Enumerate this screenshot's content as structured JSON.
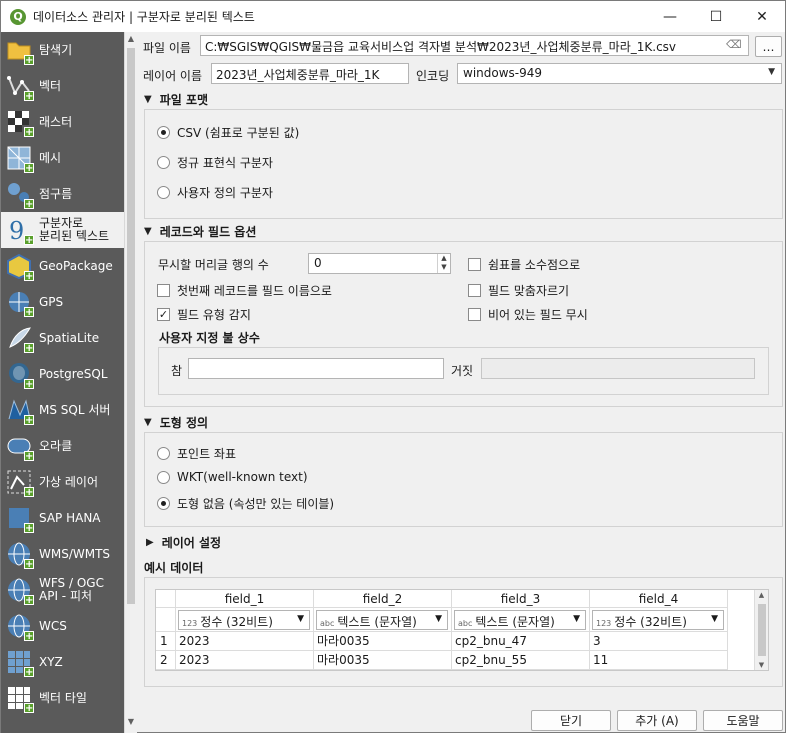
{
  "window": {
    "title": "데이터소스 관리자 | 구분자로 분리된 텍스트",
    "app_icon": "Q",
    "minimize": "—",
    "maximize": "☐",
    "close": "✕"
  },
  "sidebar": {
    "items": [
      {
        "label": "탐색기",
        "icon": "folder-icon"
      },
      {
        "label": "벡터",
        "icon": "vector-icon"
      },
      {
        "label": "래스터",
        "icon": "raster-icon"
      },
      {
        "label": "메시",
        "icon": "mesh-icon"
      },
      {
        "label": "점구름",
        "icon": "point-cloud-icon"
      },
      {
        "label": "구분자로\n분리된 텍스트",
        "icon": "delimited-text-icon",
        "active": true
      },
      {
        "label": "GeoPackage",
        "icon": "geopackage-icon"
      },
      {
        "label": "GPS",
        "icon": "gps-icon"
      },
      {
        "label": "SpatiaLite",
        "icon": "spatialite-icon"
      },
      {
        "label": "PostgreSQL",
        "icon": "postgresql-icon"
      },
      {
        "label": "MS SQL 서버",
        "icon": "mssql-icon"
      },
      {
        "label": "오라클",
        "icon": "oracle-icon"
      },
      {
        "label": "가상 레이어",
        "icon": "virtual-layer-icon"
      },
      {
        "label": "SAP HANA",
        "icon": "sap-hana-icon"
      },
      {
        "label": "WMS/WMTS",
        "icon": "wms-icon"
      },
      {
        "label": "WFS / OGC\nAPI - 피처",
        "icon": "wfs-icon"
      },
      {
        "label": "WCS",
        "icon": "wcs-icon"
      },
      {
        "label": "XYZ",
        "icon": "xyz-icon"
      },
      {
        "label": "벡터 타일",
        "icon": "vector-tile-icon"
      }
    ]
  },
  "file": {
    "label": "파일 이름",
    "value": "C:₩SGIS₩QGIS₩물금읍 교육서비스업 격자별 분석₩2023년_사업체중분류_마라_1K.csv",
    "clear": "⌫",
    "browse": "…"
  },
  "layer": {
    "label": "레이어 이름",
    "value": "2023년_사업체중분류_마라_1K",
    "encoding_label": "인코딩",
    "encoding_value": "windows-949"
  },
  "file_format": {
    "title": "파일 포맷",
    "options": [
      "CSV (쉼표로 구분된 값)",
      "정규 표현식 구분자",
      "사용자 정의 구분자"
    ],
    "selected": 0
  },
  "records": {
    "title": "레코드와 필드 옵션",
    "skip_label": "무시할 머리글 행의 수",
    "skip_value": "0",
    "first_record_names": "첫번째 레코드를 필드 이름으로",
    "detect_types": "필드 유형 감지",
    "decimal_comma": "쉼표를 소수점으로",
    "trim_fields": "필드 맞춤자르기",
    "discard_empty": "비어 있는 필드 무시",
    "detect_types_checked": "✓",
    "custom_bool_title": "사용자 지정 불 상수",
    "true_label": "참",
    "false_label": "거짓"
  },
  "geometry": {
    "title": "도형 정의",
    "options": [
      "포인트 좌표",
      "WKT(well-known text)",
      "도형 없음 (속성만 있는 테이블)"
    ],
    "selected": 2
  },
  "layer_settings": {
    "title": "레이어 설정"
  },
  "sample": {
    "title": "예시 데이터",
    "columns": [
      {
        "name": "field_1",
        "type_tag": "123",
        "type": "정수 (32비트)"
      },
      {
        "name": "field_2",
        "type_tag": "abc",
        "type": "텍스트 (문자열)"
      },
      {
        "name": "field_3",
        "type_tag": "abc",
        "type": "텍스트 (문자열)"
      },
      {
        "name": "field_4",
        "type_tag": "123",
        "type": "정수 (32비트)"
      }
    ],
    "rows": [
      {
        "num": "1",
        "cells": [
          "2023",
          "마라0035",
          "cp2_bnu_47",
          "3"
        ]
      },
      {
        "num": "2",
        "cells": [
          "2023",
          "마라0035",
          "cp2_bnu_55",
          "11"
        ]
      }
    ]
  },
  "buttons": {
    "close": "닫기",
    "add": "추가 (A)",
    "help": "도움말"
  }
}
